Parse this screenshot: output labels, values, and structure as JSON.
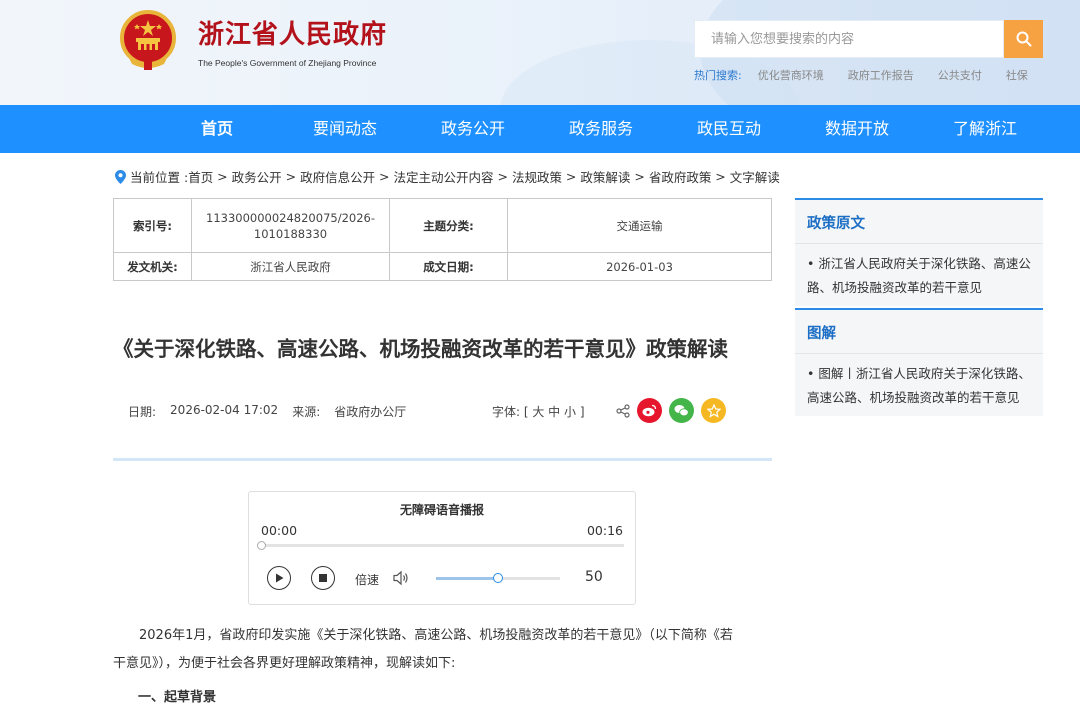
{
  "header": {
    "site_title": "浙江省人民政府",
    "site_subtitle": "The People's Government of Zhejiang Province",
    "search_placeholder": "请输入您想要搜索的内容",
    "hot_label": "热门搜索:",
    "hot_items": [
      "优化营商环境",
      "政府工作报告",
      "公共支付",
      "社保"
    ]
  },
  "nav": {
    "items": [
      "首页",
      "要闻动态",
      "政务公开",
      "政务服务",
      "政民互动",
      "数据开放",
      "了解浙江"
    ]
  },
  "breadcrumb": {
    "prefix": "当前位置 :",
    "path": [
      "首页",
      "政务公开",
      "政府信息公开",
      "法定主动公开内容",
      "法规政策",
      "政策解读",
      "省政府政策",
      "文字解读"
    ]
  },
  "info": {
    "index_label": "索引号:",
    "index_value": "113300000024820075/2026-1010188330",
    "topic_label": "主题分类:",
    "topic_value": "交通运输",
    "issuer_label": "发文机关:",
    "issuer_value": "浙江省人民政府",
    "date_label": "成文日期:",
    "date_value": "2026-01-03"
  },
  "article": {
    "title": "《关于深化铁路、高速公路、机场投融资改革的若干意见》政策解读",
    "date_label": "日期:",
    "date_value": "2026-02-04 17:02",
    "source_label": "来源:",
    "source_value": "省政府办公厅",
    "font_label": "字体:",
    "font_options": "[ 大 中 小 ]",
    "paragraph1": "2026年1月，省政府印发实施《关于深化铁路、高速公路、机场投融资改革的若干意见》（以下简称《若干意见》），为便于社会各界更好理解政策精神，现解读如下:",
    "section1": "一、起草背景"
  },
  "player": {
    "title": "无障碍语音播报",
    "current_time": "00:00",
    "duration": "00:16",
    "progress": 0,
    "speed_label": "倍速",
    "volume": 50
  },
  "sidebar": {
    "block1_title": "政策原文",
    "block1_item": "• 浙江省人民政府关于深化铁路、高速公路、机场投融资改革的若干意见",
    "block2_title": "图解",
    "block2_item": "• 图解丨浙江省人民政府关于深化铁路、高速公路、机场投融资改革的若干意见"
  },
  "colors": {
    "nav_bg": "#1e90ff",
    "brand_red": "#b3121b",
    "search_btn": "#f6a243",
    "link_blue": "#1c6fc4"
  },
  "icons": [
    "location-pin-icon",
    "search-icon",
    "share-icon",
    "weibo-icon",
    "wechat-icon",
    "favorite-star-icon",
    "play-icon",
    "stop-icon",
    "volume-icon",
    "national-emblem-icon"
  ]
}
